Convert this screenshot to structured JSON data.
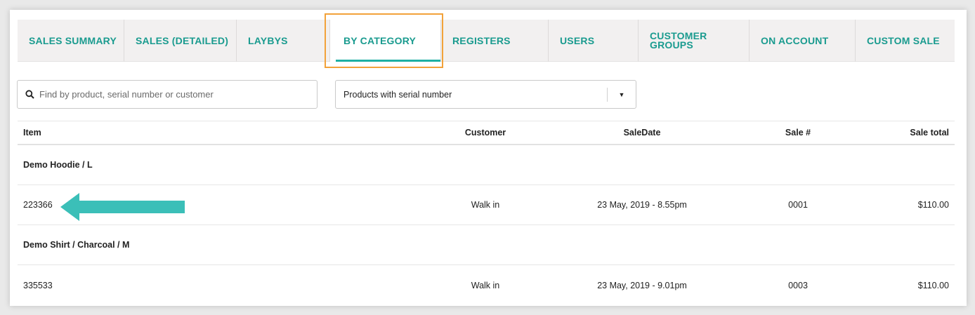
{
  "tabs": [
    {
      "label": "SALES SUMMARY",
      "active": false
    },
    {
      "label": "SALES (DETAILED)",
      "active": false
    },
    {
      "label": "LAYBYS",
      "active": false
    },
    {
      "label": "BY CATEGORY",
      "active": true
    },
    {
      "label": "REGISTERS",
      "active": false
    },
    {
      "label": "USERS",
      "active": false
    },
    {
      "label": "CUSTOMER\nGROUPS",
      "active": false
    },
    {
      "label": "ON ACCOUNT",
      "active": false
    },
    {
      "label": "CUSTOM SALE",
      "active": false
    }
  ],
  "search": {
    "placeholder": "Find by product, serial number or customer",
    "value": "",
    "icon": "search-icon"
  },
  "filter": {
    "selected": "Products with serial number",
    "icon": "caret-down-icon"
  },
  "table": {
    "headers": {
      "item": "Item",
      "customer": "Customer",
      "sale_date": "SaleDate",
      "sale_number": "Sale #",
      "sale_total": "Sale total"
    },
    "groups": [
      {
        "name": "Demo Hoodie / L",
        "rows": [
          {
            "item": "223366",
            "customer": "Walk in",
            "sale_date": "23 May, 2019 - 8.55pm",
            "sale_number": "0001",
            "sale_total": "$110.00"
          }
        ]
      },
      {
        "name": "Demo Shirt / Charcoal / M",
        "rows": [
          {
            "item": "335533",
            "customer": "Walk in",
            "sale_date": "23 May, 2019 - 9.01pm",
            "sale_number": "0003",
            "sale_total": "$110.00"
          }
        ]
      }
    ]
  },
  "colors": {
    "accent": "#1a9b8f",
    "active_underline": "#1fb0a4",
    "highlight_box": "#f2a23a",
    "arrow": "#3bbfb8"
  }
}
